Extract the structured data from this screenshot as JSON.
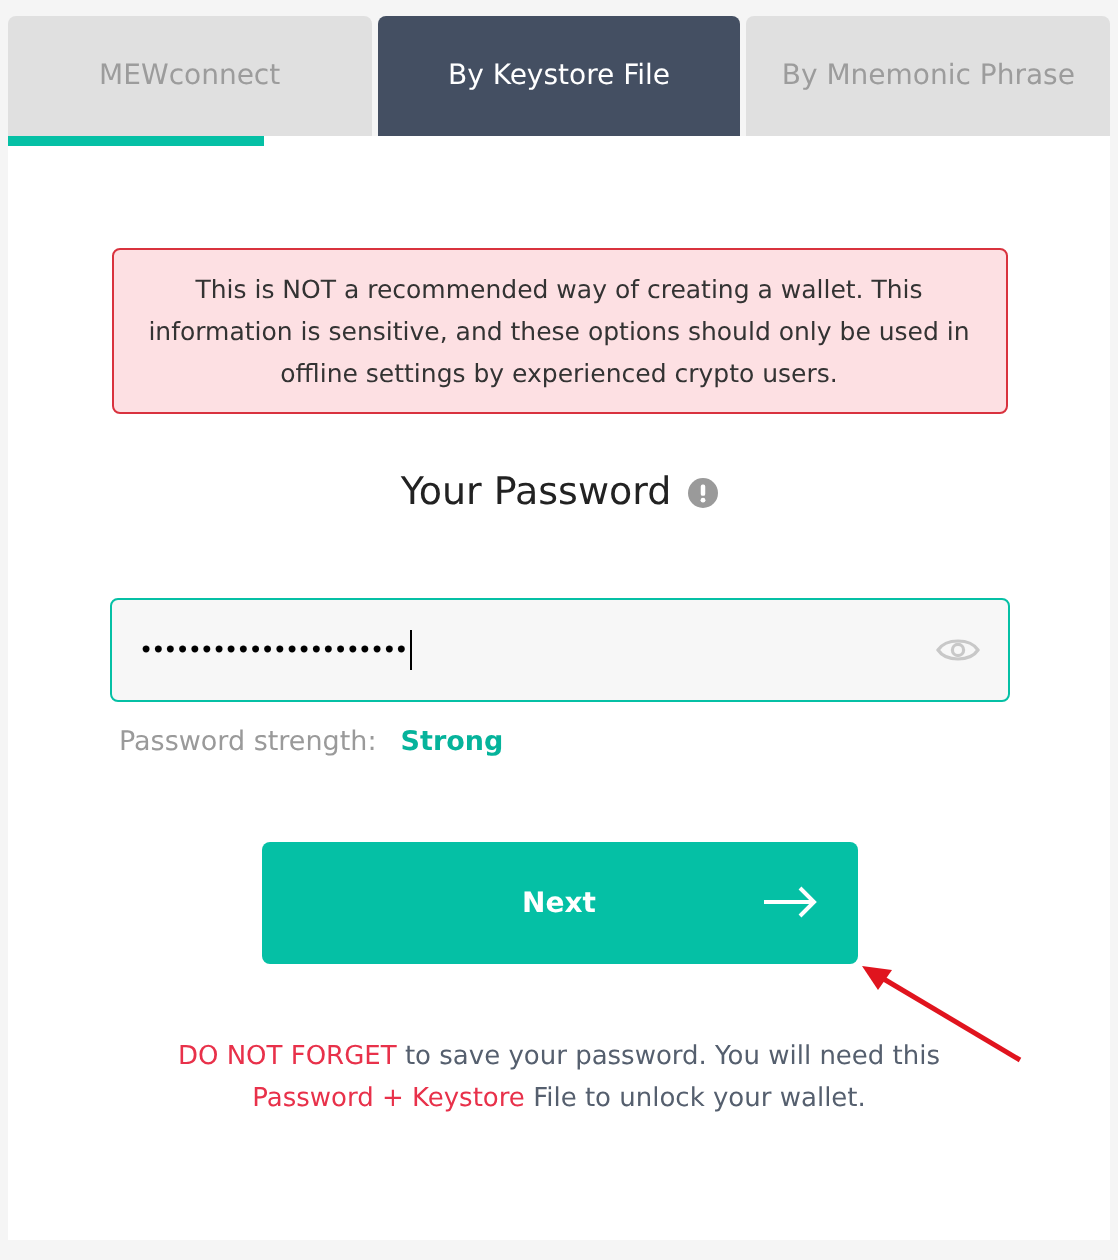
{
  "tabs": [
    {
      "label": "MEWconnect",
      "selected": false,
      "underlined": true
    },
    {
      "label": "By Keystore File",
      "selected": true,
      "underlined": false
    },
    {
      "label": "By Mnemonic Phrase",
      "selected": false,
      "underlined": false
    }
  ],
  "warning": "This is NOT a recommended way of creating a wallet. This information is sensitive, and these options should only be used in offline settings by experienced crypto users.",
  "heading": "Your Password",
  "password": {
    "value": "••••••••••••••••••••••",
    "focused": true
  },
  "strength": {
    "label": "Password strength:",
    "value": "Strong"
  },
  "next_button": {
    "label": "Next"
  },
  "note": [
    {
      "kind": "emphasis",
      "text": "DO NOT FORGET"
    },
    {
      "kind": "plain",
      "text": " to save your password. You will need this "
    },
    {
      "kind": "emphasis",
      "text": "Password + Keystore"
    },
    {
      "kind": "plain",
      "text": " File to unlock your wallet."
    }
  ]
}
